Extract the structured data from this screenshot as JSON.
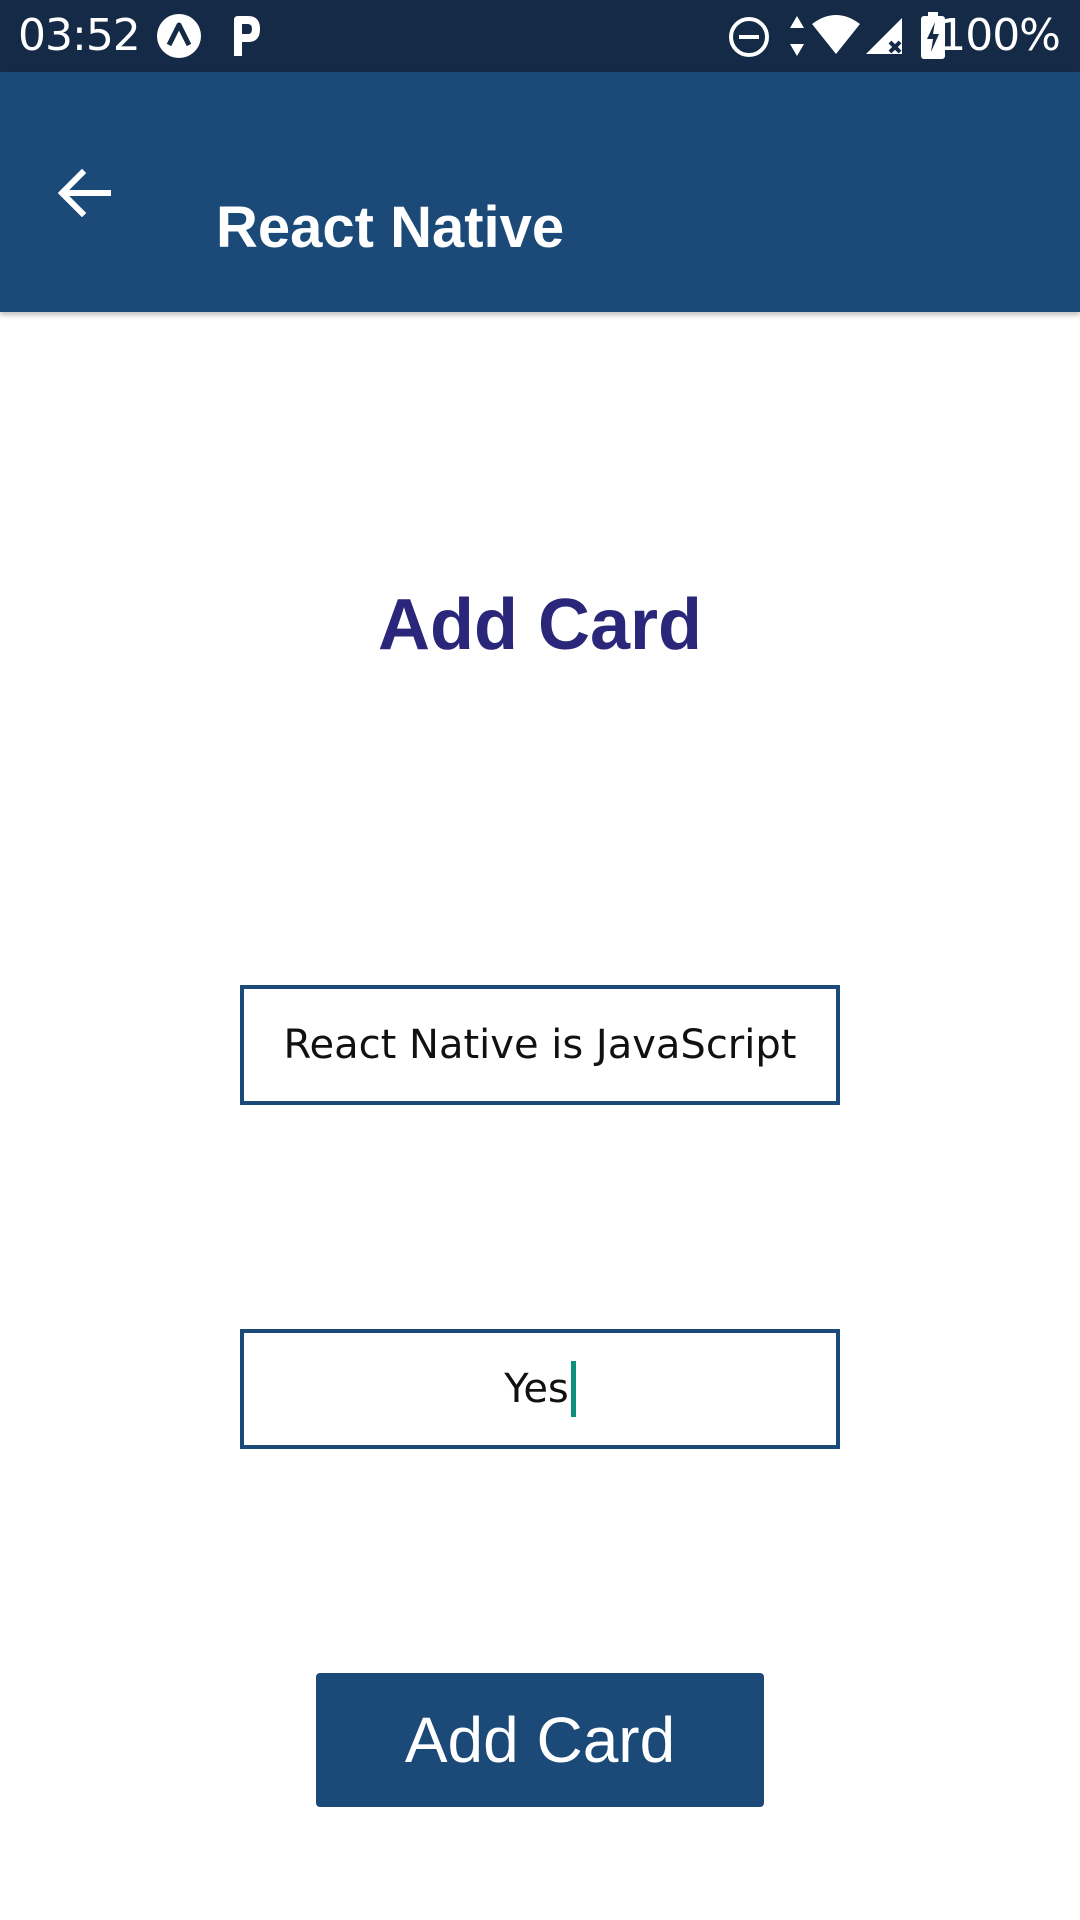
{
  "status_bar": {
    "time": "03:52",
    "battery_text": "100%",
    "icons": [
      "expo-icon",
      "p-icon",
      "do-not-disturb-icon",
      "data-arrows-icon",
      "wifi-icon",
      "signal-icon",
      "battery-icon"
    ]
  },
  "app_bar": {
    "title": "React Native",
    "back_icon": "arrow-left-icon"
  },
  "main": {
    "heading": "Add Card",
    "question_value": "React Native is JavaScript",
    "answer_value": "Yes",
    "submit_label": "Add Card"
  },
  "colors": {
    "status_bar": "#142a46",
    "primary": "#1b4a78",
    "heading": "#2a2679",
    "caret": "#0d8f7c"
  }
}
